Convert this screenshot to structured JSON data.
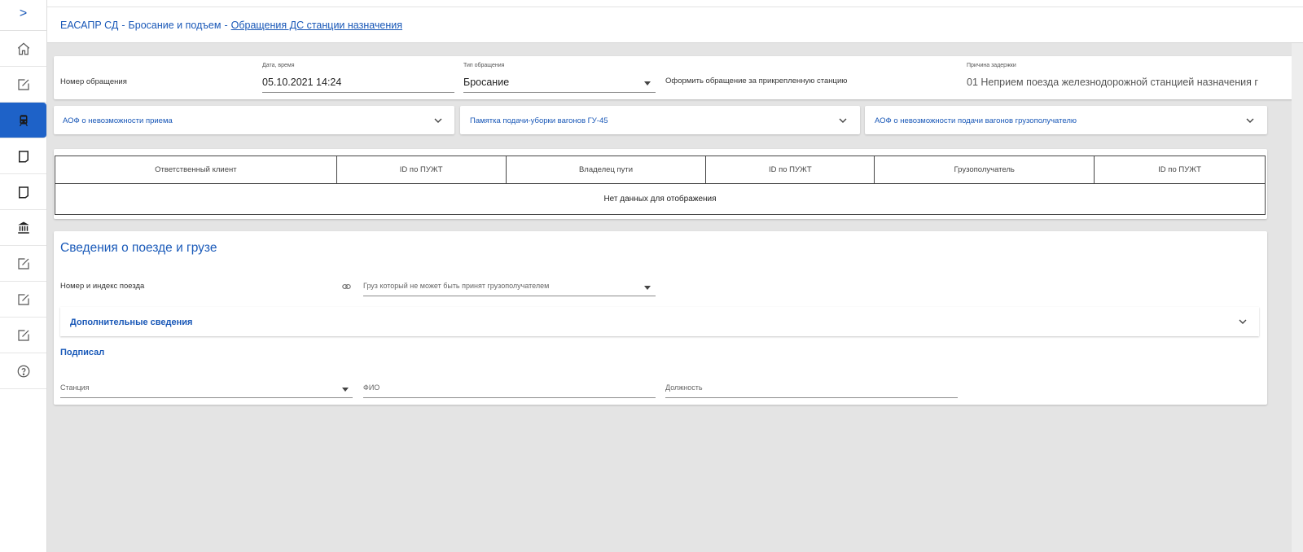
{
  "sidebar": {
    "toggle_glyph": ">",
    "items": [
      {
        "icon": "home-icon"
      },
      {
        "icon": "edit-note-icon"
      },
      {
        "icon": "train-icon"
      },
      {
        "icon": "book-icon"
      },
      {
        "icon": "book-icon"
      },
      {
        "icon": "bank-icon"
      },
      {
        "icon": "edit-note-icon"
      },
      {
        "icon": "edit-note-icon"
      },
      {
        "icon": "edit-note-icon"
      },
      {
        "icon": "help-icon"
      }
    ]
  },
  "breadcrumb": {
    "part1": "ЕАСАПР СД",
    "sep": "-",
    "part2": "Бросание и подъем",
    "link": "Обращения ДС станции назначения"
  },
  "form": {
    "number_label": "Номер обращения",
    "date_label": "Дата, время",
    "date_value": "05.10.2021 14:24",
    "type_label": "Тип обращения",
    "type_value": "Бросание",
    "attach_label": "Оформить обращение за прикрепленную станцию",
    "reason_label": "Причина задержки",
    "reason_value": "01 Неприем поезда железнодорожной станцией назначения г"
  },
  "accordions": [
    {
      "title": "АОФ о невозможности приема"
    },
    {
      "title": "Памятка подачи-уборки вагонов ГУ-45"
    },
    {
      "title": "АОФ о невозможности подачи вагонов грузополучателю"
    }
  ],
  "table": {
    "headers": [
      "Ответственный клиент",
      "ID по ПУЖТ",
      "Владелец пути",
      "ID по ПУЖТ",
      "Грузополучатель",
      "ID по ПУЖТ"
    ],
    "empty_text": "Нет данных для отображения"
  },
  "train": {
    "section_title": "Сведения о поезде и грузе",
    "train_label": "Номер и индекс поезда",
    "cargo_placeholder": "Груз который не может быть принят грузополучателем",
    "additional_title": "Дополнительные сведения",
    "signed_title": "Подписал",
    "station_placeholder": "Станция",
    "fio_placeholder": "ФИО",
    "position_placeholder": "Должность"
  },
  "colors": {
    "accent": "#1e62c8",
    "link": "#1857b7",
    "background": "#e4e4e4"
  }
}
